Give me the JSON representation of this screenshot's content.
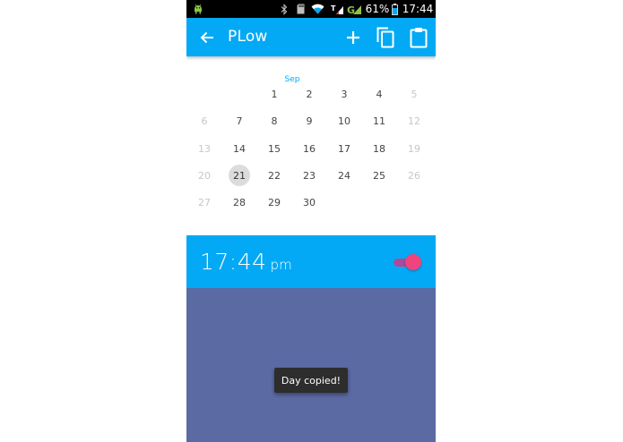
{
  "status_bar": {
    "battery_percent": "61%",
    "clock": "17:44",
    "icons": [
      "android-icon",
      "bluetooth-icon",
      "sd-card-icon",
      "wifi-icon",
      "signal-icon",
      "signal-g-icon",
      "battery-icon"
    ]
  },
  "app_bar": {
    "title": "PLow",
    "icons": [
      "back-arrow-icon",
      "plus-icon",
      "copy-icon",
      "clipboard-icon"
    ],
    "color": "#03a9f4"
  },
  "calendar": {
    "month": "Sep",
    "selected_day": "21",
    "accent_color": "#03a9f4",
    "weeks": [
      [
        "",
        "",
        "1",
        "2",
        "3",
        "4",
        "5"
      ],
      [
        "6",
        "7",
        "8",
        "9",
        "10",
        "11",
        "12"
      ],
      [
        "13",
        "14",
        "15",
        "16",
        "17",
        "18",
        "19"
      ],
      [
        "20",
        "21",
        "22",
        "23",
        "24",
        "25",
        "26"
      ],
      [
        "27",
        "28",
        "29",
        "30",
        "",
        "",
        ""
      ]
    ]
  },
  "time_panel": {
    "time": "17:44",
    "ampm": "pm",
    "toggle_on": true,
    "toggle_color": "#f0447e"
  },
  "content_area": {
    "background_color": "#5c6aa4"
  },
  "toast": {
    "text": "Day copied!"
  }
}
